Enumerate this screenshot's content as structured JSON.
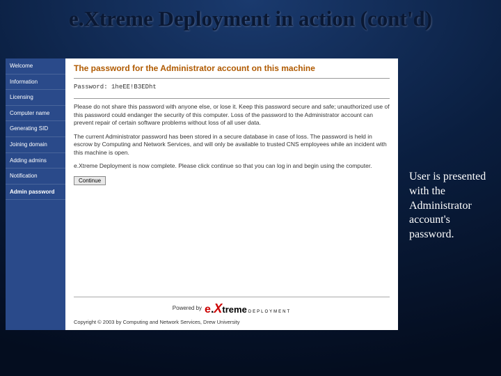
{
  "slide": {
    "title": "e.Xtreme Deployment in action (cont'd)",
    "caption": "User is presented with the Administrator account's password."
  },
  "sidebar": {
    "items": [
      {
        "label": "Welcome"
      },
      {
        "label": "Information"
      },
      {
        "label": "Licensing"
      },
      {
        "label": "Computer name"
      },
      {
        "label": "Generating SID"
      },
      {
        "label": "Joining domain"
      },
      {
        "label": "Adding admins"
      },
      {
        "label": "Notification"
      },
      {
        "label": "Admin password"
      }
    ]
  },
  "content": {
    "heading": "The password for the Administrator account on this machine",
    "password_label": "Password:",
    "password_value": "1heEE!B3EDht",
    "para1": "Please do not share this password with anyone else, or lose it. Keep this password secure and safe; unauthorized use of this password could endanger the security of this computer. Loss of the password to the Administrator account can prevent repair of certain software problems without loss of all user data.",
    "para2": "The current Administrator password has been stored in a secure database in case of loss. The password is held in escrow by Computing and Network Services, and will only be available to trusted CNS employees while an incident with this machine is open.",
    "para3": "e.Xtreme Deployment is now complete. Please click continue so that you can log in and begin using the computer.",
    "continue_label": "Continue",
    "powered_by": "Powered by",
    "logo": {
      "e": "e",
      "dot": ".",
      "x": "X",
      "rest": "treme",
      "sub": "DEPLOYMENT"
    },
    "copyright": "Copyright © 2003 by Computing and Network Services, Drew University"
  }
}
